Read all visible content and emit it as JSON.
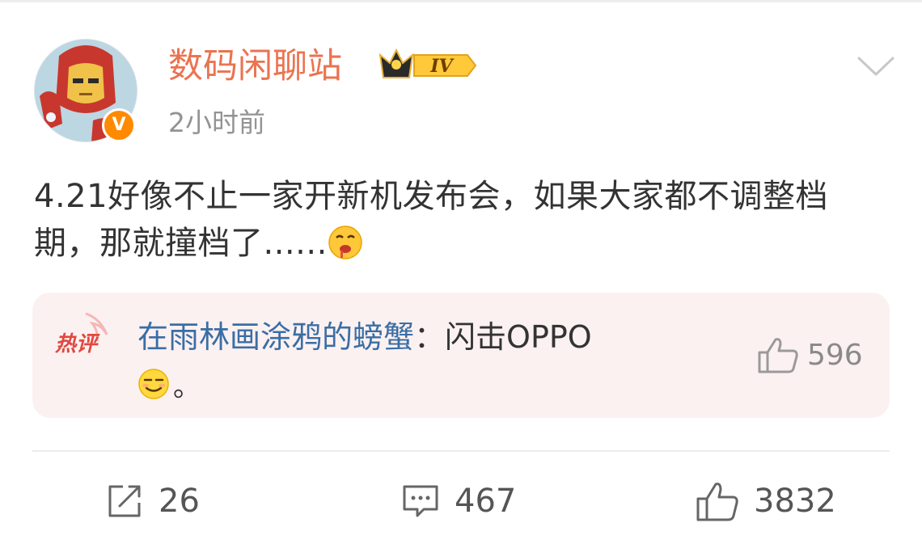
{
  "post": {
    "author": "数码闲聊站",
    "level_badge": "IV",
    "verified_badge": "V",
    "timestamp": "2小时前",
    "text_part1": "4.21好像不止一家开新机发布会，如果大家都不调整档期，那就撞档了......",
    "text_emoji": "drooling-face-emoji"
  },
  "hot_comment": {
    "tag": "热评",
    "author": "在雨林画涂鸦的螃蟹",
    "colon": "：",
    "text": "闪击OPPO",
    "emoji": "smirk-face-emoji",
    "period": "。",
    "likes": "596"
  },
  "actions": {
    "share_count": "26",
    "comment_count": "467",
    "like_count": "3832"
  },
  "colors": {
    "author": "#eb7350",
    "link": "#3a6ea5",
    "hot_bg": "#fcf1f1",
    "muted": "#939393"
  }
}
